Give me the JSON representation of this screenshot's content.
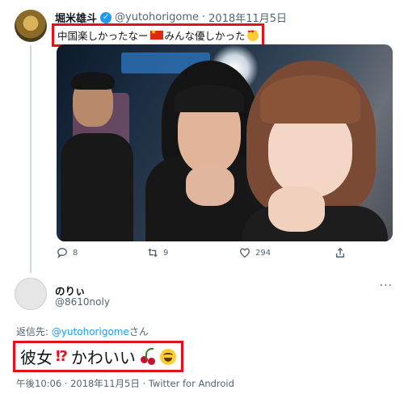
{
  "tweet": {
    "author_name": "堀米雄斗",
    "handle": "@yutohorigome",
    "separator": "·",
    "date": "2018年11月5日",
    "text_part1": "中国楽しかったなー",
    "text_part2": "みんな優しかった",
    "flag_icon": "china-flag-icon",
    "emoji_icon": "heart-eyes-emoji-icon",
    "actions": {
      "reply_count": "8",
      "retweet_count": "9",
      "like_count": "294"
    }
  },
  "reply": {
    "author_name": "のりぃ",
    "handle": "@8610noly",
    "more_label": "···",
    "reply_to_prefix": "返信先: ",
    "reply_to_user": "@yutohorigome",
    "reply_to_suffix": "さん",
    "text_part1": "彼女",
    "text_excl": "⁉",
    "text_part2": " かわいい",
    "timestamp_line": "午後10:06 · 2018年11月5日 · Twitter for Android"
  },
  "colors": {
    "highlight_border": "#e0121b",
    "link": "#1d9bf0",
    "muted": "#536471",
    "verified": "#1d9bf0"
  }
}
